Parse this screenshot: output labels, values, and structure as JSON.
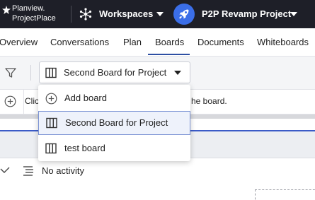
{
  "topbar": {
    "logo_line1": "Planview.",
    "logo_line2": "ProjectPlace",
    "workspaces_label": "Workspaces",
    "project_label": "P2P Revamp Project",
    "background_color": "#1e1f28",
    "project_avatar_color": "#3b6ee8"
  },
  "tabs": [
    {
      "label": "Overview",
      "active": false
    },
    {
      "label": "Conversations",
      "active": false
    },
    {
      "label": "Plan",
      "active": false
    },
    {
      "label": "Boards",
      "active": true
    },
    {
      "label": "Documents",
      "active": false
    },
    {
      "label": "Whiteboards",
      "active": false
    }
  ],
  "toolbar": {
    "board_select_label": "Second Board for Project"
  },
  "info_row": {
    "text_start": "Clic",
    "text_end": "he board."
  },
  "board_area": {
    "activity_label": "No activity",
    "accent_color": "#3b5bc7"
  },
  "dropdown": {
    "items": [
      {
        "label": "Add board",
        "icon": "plus-circle-icon",
        "selected": false
      },
      {
        "label": "Second Board for Project",
        "icon": "board-grid-icon",
        "selected": true
      },
      {
        "label": "test board",
        "icon": "board-grid-icon",
        "selected": false
      }
    ]
  }
}
